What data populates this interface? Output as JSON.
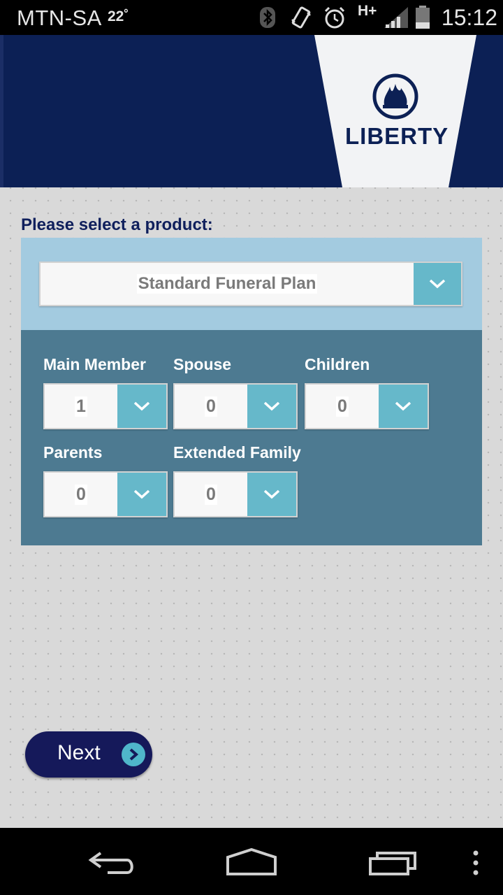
{
  "status_bar": {
    "carrier": "MTN-SA",
    "temperature": "22˚",
    "network": "H+",
    "time": "15:12",
    "icons": [
      "bluetooth-icon",
      "vibrate-icon",
      "alarm-icon",
      "signal-icon",
      "battery-icon"
    ]
  },
  "header": {
    "logo_text": "LIBERTY",
    "logo_icon": "flame-emblem-icon"
  },
  "form": {
    "prompt": "Please select a product:",
    "product": "Standard Funeral Plan",
    "fields": [
      {
        "label": "Main Member",
        "value": "1"
      },
      {
        "label": "Spouse",
        "value": "0"
      },
      {
        "label": "Children",
        "value": "0"
      },
      {
        "label": "Parents",
        "value": "0"
      },
      {
        "label": "Extended Family",
        "value": "0"
      }
    ]
  },
  "next_button": {
    "label": "Next",
    "icon": "chevron-right-circle-icon"
  },
  "nav_bar": {
    "icons": [
      "back-icon",
      "home-icon",
      "recents-icon",
      "overflow-menu-icon"
    ]
  },
  "colors": {
    "header_bg": "#0c2055",
    "accent": "#66b8ca",
    "member_panel": "#4d7a91",
    "product_panel": "#a3cbe0",
    "button_bg": "#15195a"
  }
}
